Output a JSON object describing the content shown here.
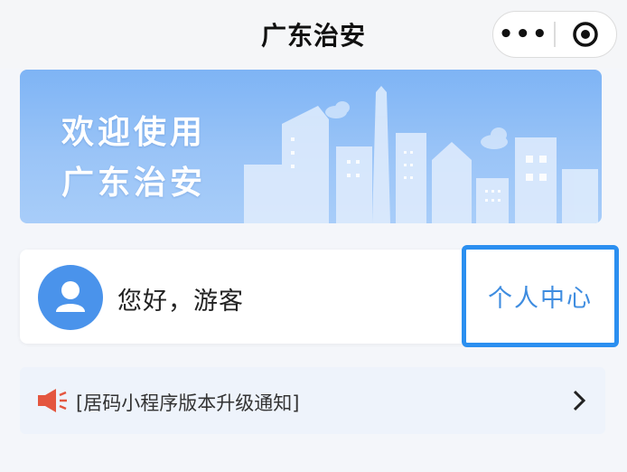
{
  "header": {
    "title": "广东治安",
    "more_icon": "•••",
    "close_icon": "target-circle-icon"
  },
  "banner": {
    "line1": "欢迎使用",
    "line2": "广东治安"
  },
  "user_card": {
    "avatar_icon": "user-avatar-icon",
    "greeting": "您好，游客",
    "personal_center": "个人中心"
  },
  "notice": {
    "icon": "speaker-icon",
    "text": "[居码小程序版本升级通知]",
    "chevron_icon": "chevron-right-icon"
  },
  "colors": {
    "accent": "#2b8ff0",
    "avatar": "#4a93eb",
    "speaker": "#e4563f",
    "banner": "#8fbdf6"
  }
}
